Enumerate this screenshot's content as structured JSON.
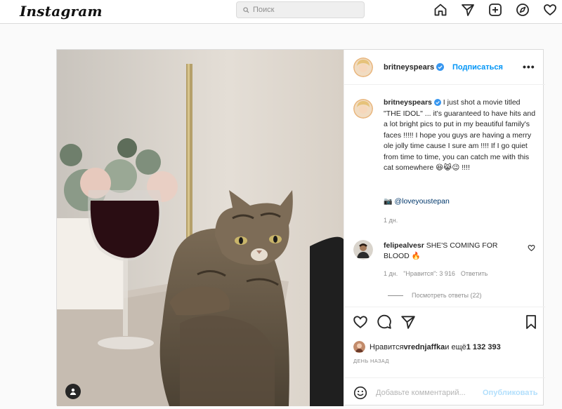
{
  "nav": {
    "logo": "Instagram",
    "search_placeholder": "Поиск",
    "icons": [
      "home-icon",
      "direct-icon",
      "new-post-icon",
      "explore-icon",
      "activity-icon"
    ]
  },
  "post": {
    "username": "britneyspears",
    "follow_label": "Подписаться",
    "more_label": "•••",
    "caption": {
      "username": "britneyspears",
      "text": " I just shot a movie titled \"THE IDOL\" ... it's guaranteed to have hits and a lot bright pics to put in my beautiful family's faces !!!!! I hope you guys are having a merry ole jolly time cause I sure am !!!! If I go quiet from time to time, you can catch me with this cat somewhere 😆😹😉 !!!!",
      "mention": "@loveyoustepan",
      "time": "1 дн."
    },
    "comment": {
      "username": "felipealvesr",
      "text": " SHE'S COMING FOR BLOOD 🔥",
      "time": "1 дн.",
      "likes": "\"Нравится\": 3 916",
      "reply": "Ответить"
    },
    "replies_label": "Посмотреть ответы (22)",
    "likes": {
      "prefix": "Нравится ",
      "user": "vrednjaffka",
      "middle": " и ещё ",
      "count": "1 132 393"
    },
    "date": "День назад",
    "add_comment_placeholder": "Добавьте комментарий...",
    "publish_label": "Опубликовать"
  },
  "colors": {
    "accent": "#0095f6",
    "muted": "#8e8e8e",
    "publish_disabled": "#b2dffc",
    "verified": "#3897f0"
  }
}
